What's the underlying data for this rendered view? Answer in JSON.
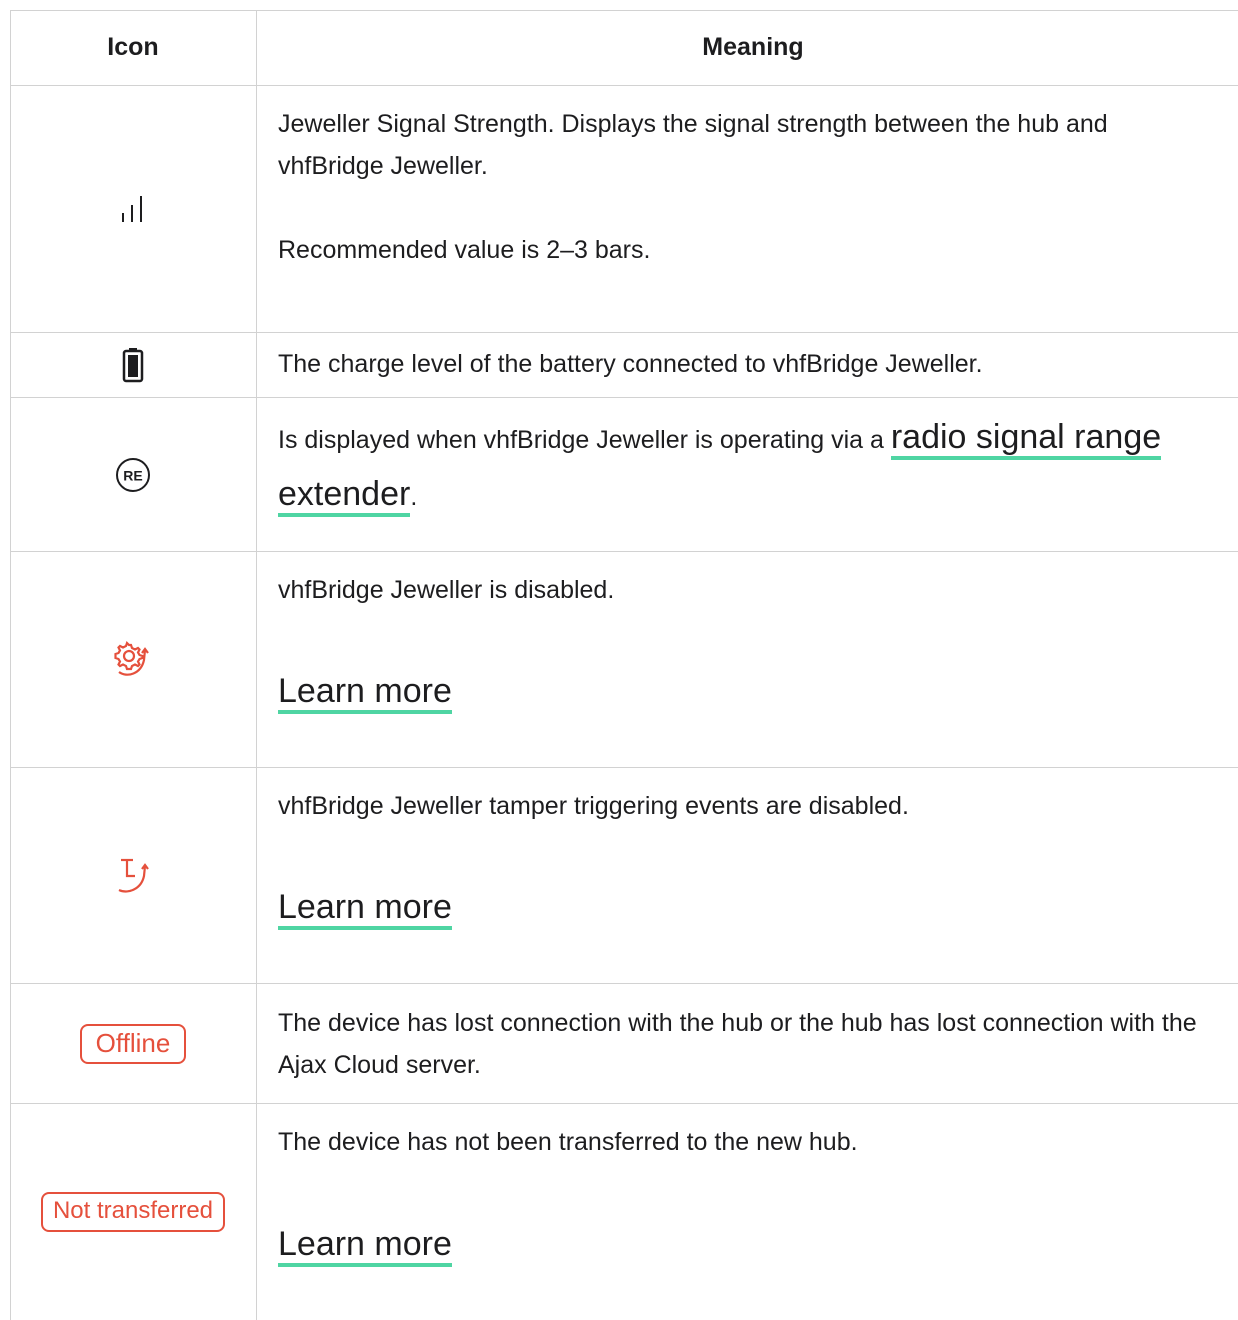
{
  "header": {
    "icon_col": "Icon",
    "meaning_col": "Meaning"
  },
  "rows": [
    {
      "icon": "signal-bars-icon",
      "text1": "Jeweller Signal Strength. Displays the signal strength between the hub and vhfBridge Jeweller.",
      "text2": "Recommended value is 2–3 bars."
    },
    {
      "icon": "battery-icon",
      "text1": "The charge level of the battery connected to vhfBridge Jeweller."
    },
    {
      "icon": "re-icon",
      "icon_label": "RE",
      "text_before": "Is displayed when vhfBridge Jeweller is operating via a ",
      "link": "radio signal range extender",
      "text_after": "."
    },
    {
      "icon": "disabled-gear-icon",
      "text1": "vhfBridge Jeweller is disabled.",
      "link": "Learn more"
    },
    {
      "icon": "tamper-disabled-icon",
      "text1": "vhfBridge Jeweller tamper triggering events are disabled.",
      "link": "Learn more"
    },
    {
      "icon": "offline-badge",
      "badge": "Offline",
      "text1": "The device has lost connection with the hub or the hub has lost connection with the Ajax Cloud server."
    },
    {
      "icon": "not-transferred-badge",
      "badge": "Not transferred",
      "text1": "The device has not been transferred to the new hub.",
      "link": "Learn more"
    }
  ],
  "colors": {
    "accent_underline": "#4fd5a3",
    "status_red": "#e5503c",
    "border": "#d2d2d2"
  }
}
